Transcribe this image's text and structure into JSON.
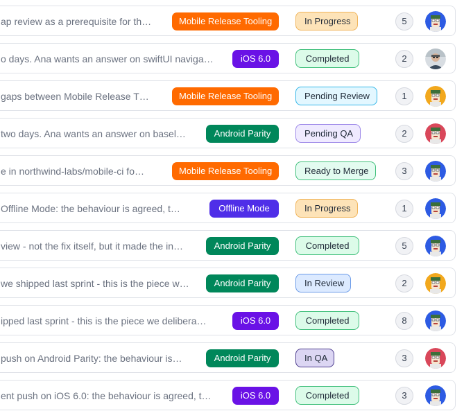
{
  "colors": {
    "mobile_release_tooling": "#ff6a00",
    "ios_6_0": "#6a12e6",
    "android_parity": "#00875a",
    "offline_mode": "#4f2ee8"
  },
  "rows": [
    {
      "title": "ap review as a prerequisite for th…",
      "tag": "Mobile Release Tooling",
      "tag_key": "mobile_release_tooling",
      "status": "In Progress",
      "status_key": "in_progress",
      "count": "5",
      "avatar": "blue-avatar"
    },
    {
      "title": "o days. Ana wants an answer on swiftUI naviga…",
      "tag": "iOS 6.0",
      "tag_key": "ios_6_0",
      "status": "Completed",
      "status_key": "completed",
      "count": "2",
      "avatar": "photo-avatar"
    },
    {
      "title": " gaps between Mobile Release T…",
      "tag": "Mobile Release Tooling",
      "tag_key": "mobile_release_tooling",
      "status": "Pending Review",
      "status_key": "pending_review",
      "count": "1",
      "avatar": "orange-avatar"
    },
    {
      "title": "two days. Ana wants an answer on basel…",
      "tag": "Android Parity",
      "tag_key": "android_parity",
      "status": "Pending QA",
      "status_key": "pending_qa",
      "count": "2",
      "avatar": "red-avatar"
    },
    {
      "title": "e in northwind-labs/mobile-ci fo…",
      "tag": "Mobile Release Tooling",
      "tag_key": "mobile_release_tooling",
      "status": "Ready to Merge",
      "status_key": "ready_to_merge",
      "count": "3",
      "avatar": "blue-avatar"
    },
    {
      "title": "Offline Mode: the behaviour is agreed, t…",
      "tag": "Offline Mode",
      "tag_key": "offline_mode",
      "status": "In Progress",
      "status_key": "in_progress",
      "count": "1",
      "avatar": "blue-avatar"
    },
    {
      "title": "view - not the fix itself, but it made the in…",
      "tag": "Android Parity",
      "tag_key": "android_parity",
      "status": "Completed",
      "status_key": "completed",
      "count": "5",
      "avatar": "blue-avatar"
    },
    {
      "title": "we shipped last sprint - this is the piece w…",
      "tag": "Android Parity",
      "tag_key": "android_parity",
      "status": "In Review",
      "status_key": "in_review",
      "count": "2",
      "avatar": "orange-avatar"
    },
    {
      "title": "ipped last sprint - this is the piece we delibera…",
      "tag": "iOS 6.0",
      "tag_key": "ios_6_0",
      "status": "Completed",
      "status_key": "completed",
      "count": "8",
      "avatar": "blue-avatar"
    },
    {
      "title": " push on Android Parity: the behaviour is…",
      "tag": "Android Parity",
      "tag_key": "android_parity",
      "status": "In QA",
      "status_key": "in_qa",
      "count": "3",
      "avatar": "red-avatar"
    },
    {
      "title": "ent push on iOS 6.0: the behaviour is agreed, t…",
      "tag": "iOS 6.0",
      "tag_key": "ios_6_0",
      "status": "Completed",
      "status_key": "completed",
      "count": "3",
      "avatar": "blue-avatar"
    }
  ],
  "status_colors": {
    "in_progress": {
      "bg": "#fde3b8",
      "border": "#f0b45a"
    },
    "completed": {
      "bg": "#dcfbe9",
      "border": "#3fbf7a"
    },
    "pending_review": {
      "bg": "#e3f7ff",
      "border": "#33b6e8"
    },
    "pending_qa": {
      "bg": "#efeaff",
      "border": "#9b86e8"
    },
    "ready_to_merge": {
      "bg": "#e3fbf0",
      "border": "#3fbf7a"
    },
    "in_review": {
      "bg": "#dceaff",
      "border": "#6a9ae8"
    },
    "in_qa": {
      "bg": "#dcd6f3",
      "border": "#4b3b8e"
    }
  }
}
